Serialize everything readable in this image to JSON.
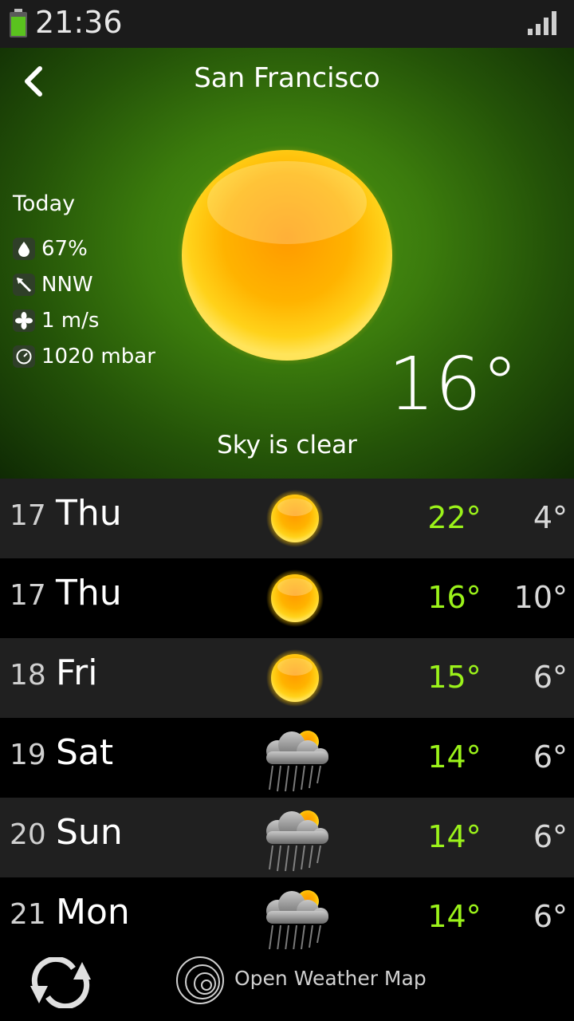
{
  "status": {
    "time": "21:36"
  },
  "header": {
    "city": "San Francisco"
  },
  "today": {
    "label": "Today",
    "humidity": "67%",
    "wind_direction": "NNW",
    "wind_speed": "1 m/s",
    "pressure": "1020 mbar",
    "temperature": "16°",
    "description": "Sky is clear"
  },
  "forecast": [
    {
      "date": "17",
      "day": "Thu",
      "icon": "sun-icon",
      "high": "22°",
      "low": "4°"
    },
    {
      "date": "17",
      "day": "Thu",
      "icon": "sun-icon",
      "high": "16°",
      "low": "10°"
    },
    {
      "date": "18",
      "day": "Fri",
      "icon": "sun-icon",
      "high": "15°",
      "low": "6°"
    },
    {
      "date": "19",
      "day": "Sat",
      "icon": "rain-cloud-sun-icon",
      "high": "14°",
      "low": "6°"
    },
    {
      "date": "20",
      "day": "Sun",
      "icon": "rain-cloud-sun-icon",
      "high": "14°",
      "low": "6°"
    },
    {
      "date": "21",
      "day": "Mon",
      "icon": "rain-cloud-sun-icon",
      "high": "14°",
      "low": "6°"
    }
  ],
  "footer": {
    "provider": "Open Weather Map"
  },
  "colors": {
    "high_temp": "#9bf21a",
    "low_temp": "#d8d8d8",
    "hero_green": "#3b7b0d"
  }
}
